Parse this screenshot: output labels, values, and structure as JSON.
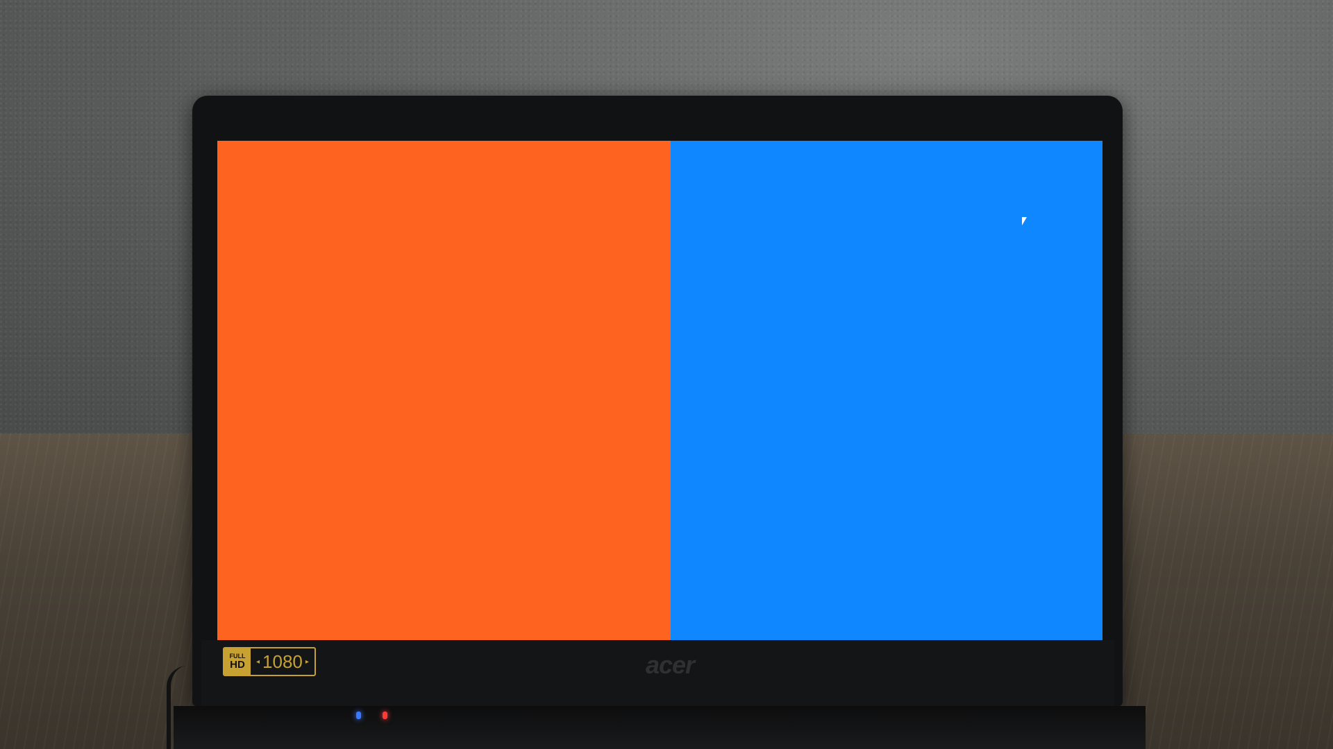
{
  "screen": {
    "left_color": "#ff6320",
    "right_color": "#0f87ff"
  },
  "badge": {
    "full": "FULL",
    "hd": "HD",
    "resolution": "1080"
  },
  "brand": {
    "logo": "acer"
  },
  "indicators": {
    "power_led_color": "#3a78ff",
    "battery_led_color": "#ff3a3a"
  }
}
